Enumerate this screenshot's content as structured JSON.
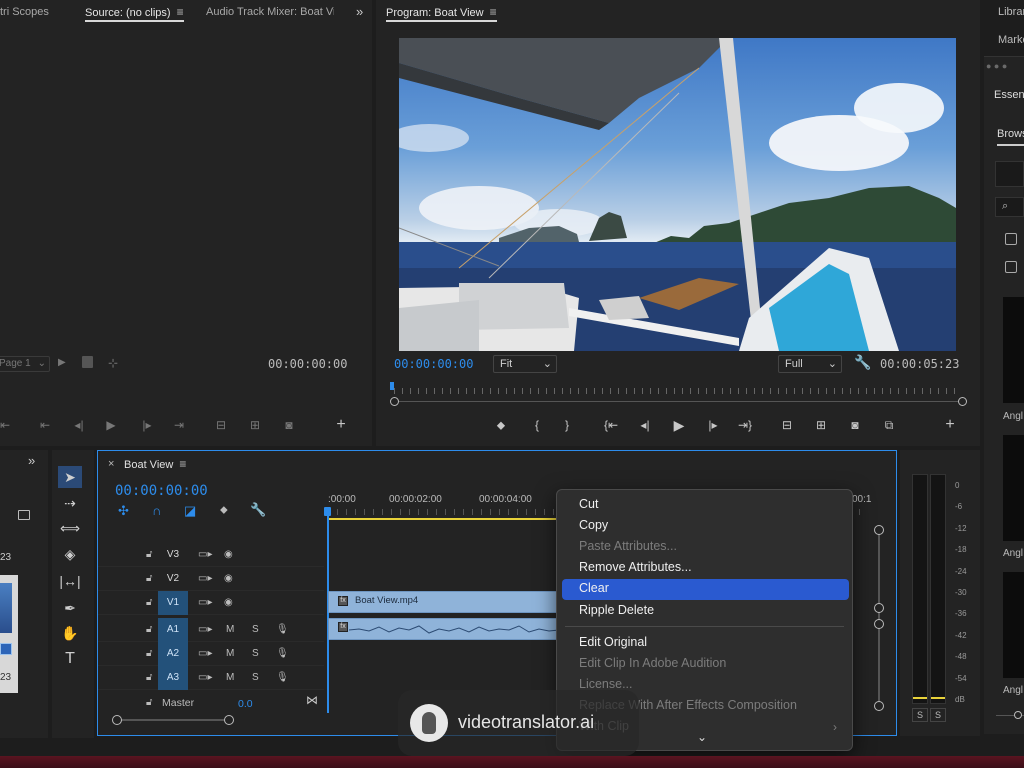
{
  "source_panel": {
    "tabs": [
      "tri Scopes",
      "Source: (no clips)",
      "Audio Track Mixer: Boat Vi"
    ],
    "more": "»",
    "page_select": "Page 1",
    "timecode": "00:00:00:00"
  },
  "program_panel": {
    "title": "Program: Boat View",
    "timecode_current": "00:00:00:00",
    "fit_select": "Fit",
    "resolution_select": "Full",
    "timecode_duration": "00:00:05:23"
  },
  "right_panel": {
    "tabs": [
      "Librar",
      "Marke"
    ],
    "essentials_title": "Essent",
    "browse_tab": "Brows",
    "angle_labels": [
      "Angl",
      "Angl",
      "Angl"
    ]
  },
  "timeline": {
    "close": "×",
    "sequence_name": "Boat View",
    "timecode": "00:00:00:00",
    "ruler_ticks": [
      ":00:00",
      "00:00:02:00",
      "00:00:04:00",
      "00:1"
    ],
    "video_tracks": [
      {
        "name": "V3",
        "highlighted": false
      },
      {
        "name": "V2",
        "highlighted": false
      },
      {
        "name": "V1",
        "highlighted": true
      }
    ],
    "audio_tracks": [
      {
        "name": "A1",
        "highlighted": true
      },
      {
        "name": "A2",
        "highlighted": true
      },
      {
        "name": "A3",
        "highlighted": true
      }
    ],
    "master_label": "Master",
    "master_value": "0.0",
    "m_label": "M",
    "s_label": "S",
    "clip_video_name": "Boat View.mp4"
  },
  "project_strip": {
    "more": "»",
    "num1": "23",
    "num2": "23"
  },
  "audio_meter": {
    "labels": [
      "0",
      "-6",
      "-12",
      "-18",
      "-24",
      "-30",
      "-36",
      "-42",
      "-48",
      "-54",
      "dB"
    ],
    "solo_labels": [
      "S",
      "S"
    ]
  },
  "context_menu": {
    "items": [
      {
        "label": "Cut",
        "enabled": true
      },
      {
        "label": "Copy",
        "enabled": true
      },
      {
        "label": "Paste Attributes...",
        "enabled": false
      },
      {
        "label": "Remove Attributes...",
        "enabled": true
      },
      {
        "label": "Clear",
        "enabled": true,
        "highlighted": true
      },
      {
        "label": "Ripple Delete",
        "enabled": true
      },
      {
        "label": "Edit Original",
        "enabled": true
      },
      {
        "label": "Edit Clip In Adobe Audition",
        "enabled": false
      },
      {
        "label": "License...",
        "enabled": false
      },
      {
        "label": "Replace With After Effects Composition",
        "enabled": false
      },
      {
        "label": "With Clip",
        "enabled": false
      }
    ],
    "scroll_more": "⌄"
  },
  "watermark": {
    "text": "videotranslator.ai"
  },
  "colors": {
    "accent_blue": "#2d8ceb",
    "menu_highlight": "#2a5ad0",
    "track_highlight": "#23517a",
    "clip_video": "#8fb3d9",
    "playhead_yellow": "#e8d23a"
  }
}
